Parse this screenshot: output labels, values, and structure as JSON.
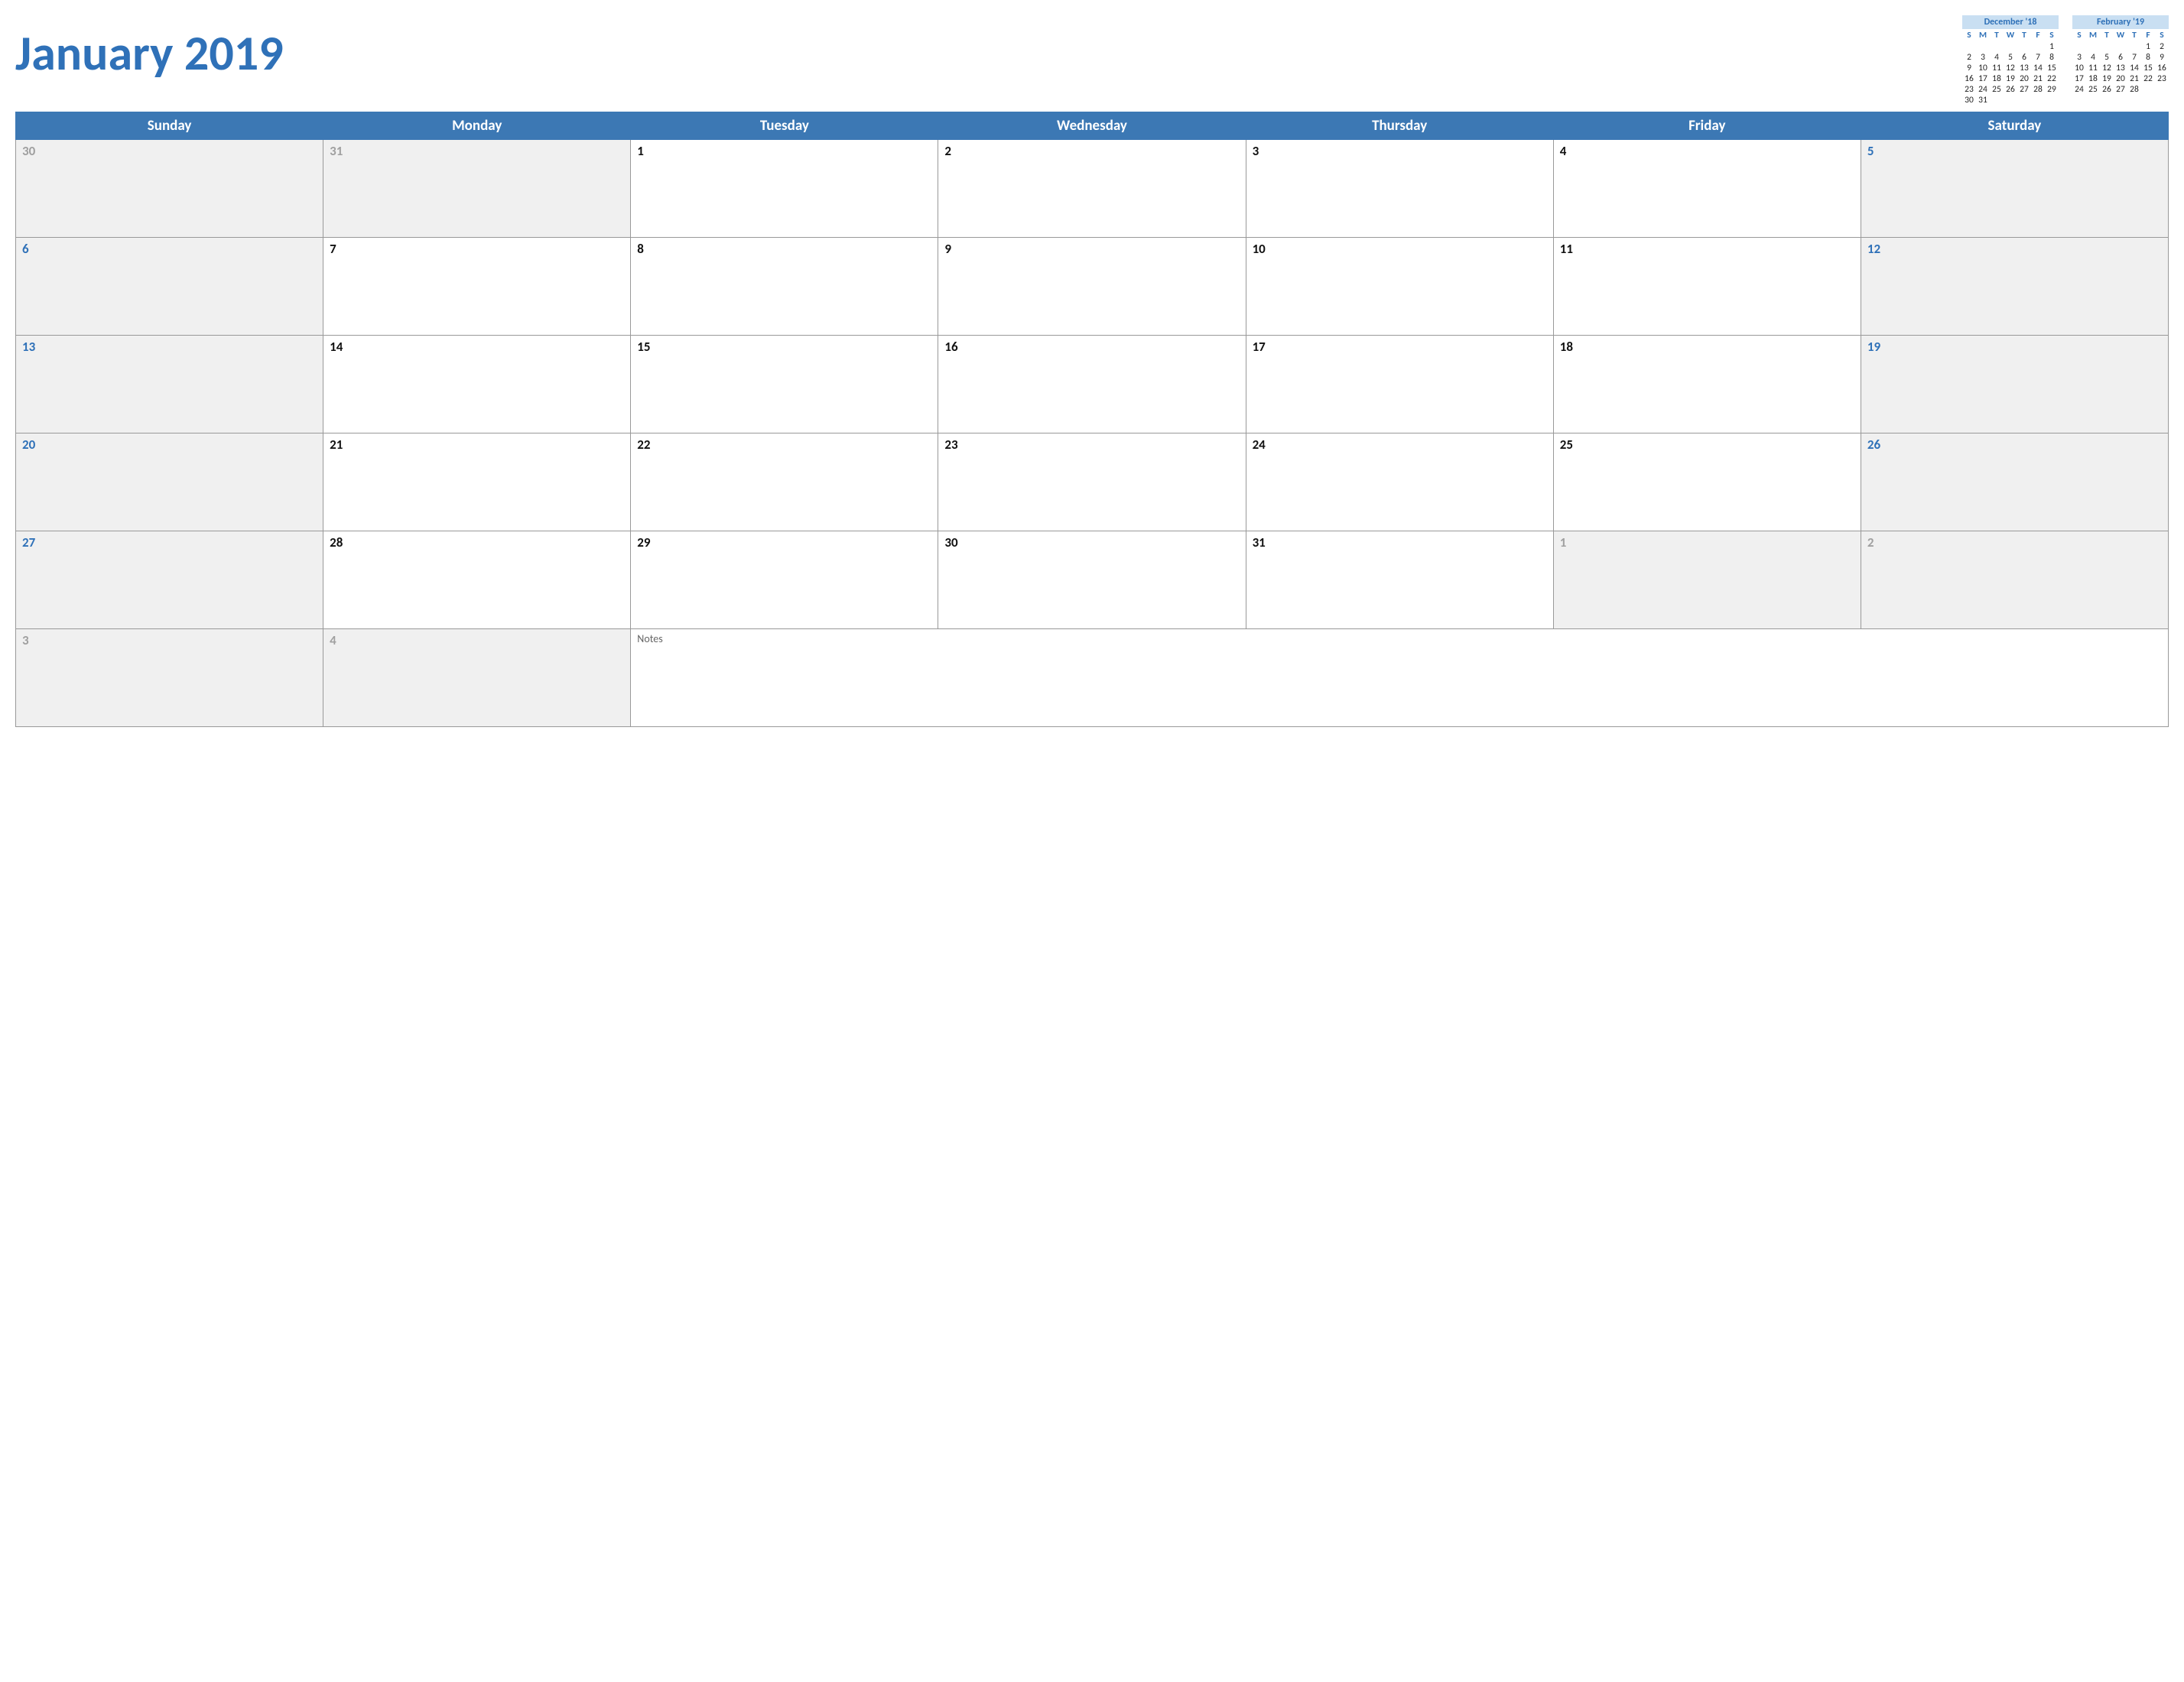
{
  "title": "January 2019",
  "day_headers": [
    "Sunday",
    "Monday",
    "Tuesday",
    "Wednesday",
    "Thursday",
    "Friday",
    "Saturday"
  ],
  "mini_dow": [
    "S",
    "M",
    "T",
    "W",
    "T",
    "F",
    "S"
  ],
  "mini_prev": {
    "title": "December '18",
    "lead_blanks": 6,
    "days": [
      1,
      2,
      3,
      4,
      5,
      6,
      7,
      8,
      9,
      10,
      11,
      12,
      13,
      14,
      15,
      16,
      17,
      18,
      19,
      20,
      21,
      22,
      23,
      24,
      25,
      26,
      27,
      28,
      29,
      30,
      31
    ]
  },
  "mini_next": {
    "title": "February '19",
    "lead_blanks": 5,
    "days": [
      1,
      2,
      3,
      4,
      5,
      6,
      7,
      8,
      9,
      10,
      11,
      12,
      13,
      14,
      15,
      16,
      17,
      18,
      19,
      20,
      21,
      22,
      23,
      24,
      25,
      26,
      27,
      28
    ]
  },
  "weeks": [
    [
      {
        "n": 30,
        "kind": "other"
      },
      {
        "n": 31,
        "kind": "other"
      },
      {
        "n": 1,
        "kind": "day"
      },
      {
        "n": 2,
        "kind": "day"
      },
      {
        "n": 3,
        "kind": "day"
      },
      {
        "n": 4,
        "kind": "day"
      },
      {
        "n": 5,
        "kind": "weekend"
      }
    ],
    [
      {
        "n": 6,
        "kind": "weekend"
      },
      {
        "n": 7,
        "kind": "day"
      },
      {
        "n": 8,
        "kind": "day"
      },
      {
        "n": 9,
        "kind": "day"
      },
      {
        "n": 10,
        "kind": "day"
      },
      {
        "n": 11,
        "kind": "day"
      },
      {
        "n": 12,
        "kind": "weekend"
      }
    ],
    [
      {
        "n": 13,
        "kind": "weekend"
      },
      {
        "n": 14,
        "kind": "day"
      },
      {
        "n": 15,
        "kind": "day"
      },
      {
        "n": 16,
        "kind": "day"
      },
      {
        "n": 17,
        "kind": "day"
      },
      {
        "n": 18,
        "kind": "day"
      },
      {
        "n": 19,
        "kind": "weekend"
      }
    ],
    [
      {
        "n": 20,
        "kind": "weekend"
      },
      {
        "n": 21,
        "kind": "day"
      },
      {
        "n": 22,
        "kind": "day"
      },
      {
        "n": 23,
        "kind": "day"
      },
      {
        "n": 24,
        "kind": "day"
      },
      {
        "n": 25,
        "kind": "day"
      },
      {
        "n": 26,
        "kind": "weekend"
      }
    ],
    [
      {
        "n": 27,
        "kind": "weekend"
      },
      {
        "n": 28,
        "kind": "day"
      },
      {
        "n": 29,
        "kind": "day"
      },
      {
        "n": 30,
        "kind": "day"
      },
      {
        "n": 31,
        "kind": "day"
      },
      {
        "n": 1,
        "kind": "other"
      },
      {
        "n": 2,
        "kind": "other"
      }
    ]
  ],
  "last_row": [
    {
      "n": 3,
      "kind": "other"
    },
    {
      "n": 4,
      "kind": "other"
    }
  ],
  "notes_label": "Notes"
}
